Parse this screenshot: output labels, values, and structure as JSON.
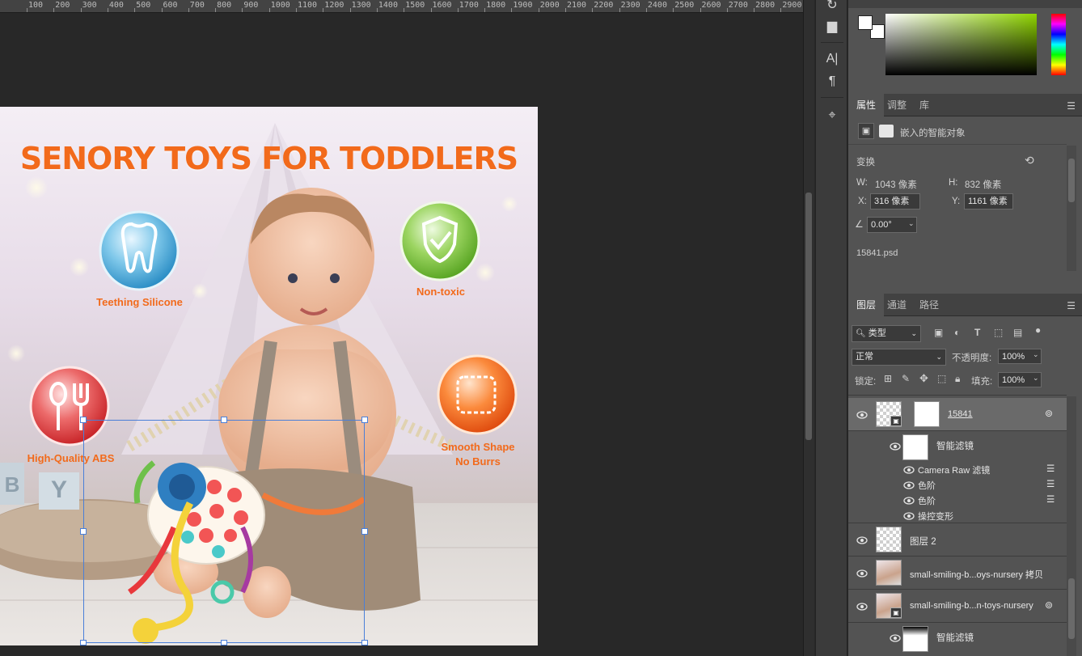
{
  "ruler": {
    "ticks": [
      "100",
      "200",
      "300",
      "400",
      "500",
      "600",
      "700",
      "800",
      "900",
      "1000",
      "1100",
      "1200",
      "1300",
      "1400",
      "1500",
      "1600",
      "1700",
      "1800",
      "1900",
      "2000",
      "2100",
      "2200",
      "2300",
      "2400",
      "2500",
      "2600",
      "2700",
      "2800",
      "2900"
    ]
  },
  "document": {
    "headline": "SENORY TOYS FOR TODDLERS",
    "badges": {
      "teething": "Teething Silicone",
      "nontoxic": "Non-toxic",
      "abs": "High-Quality ABS",
      "smooth_line1": "Smooth Shape",
      "smooth_line2": "No Burrs"
    },
    "blocks": [
      "B",
      "Y"
    ]
  },
  "properties": {
    "tabs": [
      "属性",
      "调整",
      "库"
    ],
    "object_type": "嵌入的智能对象",
    "transform_label": "变换",
    "w_label": "W:",
    "w_value": "1043 像素",
    "h_label": "H:",
    "h_value": "832 像素",
    "x_label": "X:",
    "x_value": "316 像素",
    "y_label": "Y:",
    "y_value": "1161 像素",
    "angle_value": "0.00°",
    "filename": "15841.psd"
  },
  "layers_panel": {
    "tabs": [
      "图层",
      "通道",
      "路径"
    ],
    "filter_kind": "类型",
    "blend_mode": "正常",
    "opacity_label": "不透明度:",
    "opacity_value": "100%",
    "lock_label": "锁定:",
    "fill_label": "填充:",
    "fill_value": "100%",
    "layers": [
      {
        "name": "15841"
      },
      {
        "name": "智能滤镜"
      },
      {
        "name": "Camera Raw 滤镜"
      },
      {
        "name": "色阶"
      },
      {
        "name": "色阶"
      },
      {
        "name": "操控变形"
      },
      {
        "name": "图层 2"
      },
      {
        "name": "small-smiling-b...oys-nursery 拷贝"
      },
      {
        "name": "small-smiling-b...n-toys-nursery"
      },
      {
        "name": "智能滤镜"
      }
    ]
  },
  "colors": {
    "accent_orange": "#f26a1b",
    "selection_blue": "#4a7fd8",
    "panel_bg": "#535353"
  }
}
